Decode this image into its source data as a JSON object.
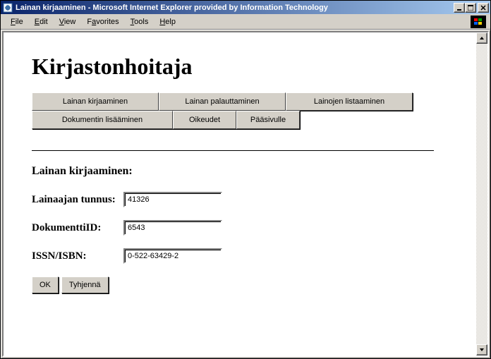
{
  "window": {
    "title": "Lainan kirjaaminen - Microsoft Internet Explorer provided by Information Technology"
  },
  "menu": {
    "file": "File",
    "edit": "Edit",
    "view": "View",
    "favorites": "Favorites",
    "tools": "Tools",
    "help": "Help"
  },
  "page": {
    "heading": "Kirjastonhoitaja",
    "nav": {
      "row1": [
        "Lainan kirjaaminen",
        "Lainan palauttaminen",
        "Lainojen listaaminen"
      ],
      "row2": [
        "Dokumentin lisääminen",
        "Oikeudet",
        "Pääsivulle"
      ]
    },
    "section_title": "Lainan kirjaaminen:",
    "form": {
      "borrower_label": "Lainaajan tunnus:",
      "borrower_value": "41326",
      "document_label": "DokumenttiID:",
      "document_value": "6543",
      "issn_label": "ISSN/ISBN:",
      "issn_value": "0-522-63429-2"
    },
    "buttons": {
      "ok": "OK",
      "clear": "Tyhjennä"
    }
  }
}
